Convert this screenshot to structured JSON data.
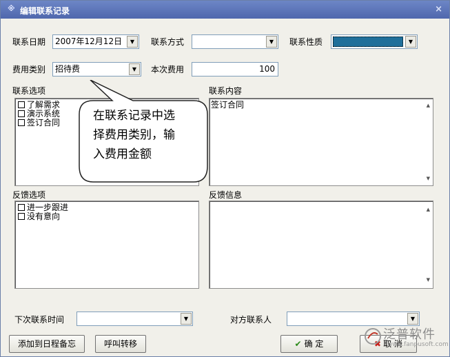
{
  "window": {
    "title": "编辑联系记录",
    "close_glyph": "×"
  },
  "form": {
    "contact_date_label": "联系日期",
    "contact_date_value": "2007年12月12日",
    "contact_method_label": "联系方式",
    "contact_method_value": "",
    "contact_nature_label": "联系性质",
    "contact_nature_value": "",
    "contact_nature_color": "#1f6f9a",
    "expense_type_label": "费用类别",
    "expense_type_value": "招待费",
    "expense_amount_label": "本次费用",
    "expense_amount_value": "100",
    "contact_options_label": "联系选项",
    "contact_options": [
      "了解需求",
      "演示系统",
      "签订合同"
    ],
    "contact_content_label": "联系内容",
    "contact_content_value": "签订合同",
    "feedback_options_label": "反馈选项",
    "feedback_options": [
      "进一步跟进",
      "没有意向"
    ],
    "feedback_info_label": "反馈信息",
    "feedback_info_value": "",
    "next_contact_label": "下次联系时间",
    "next_contact_value": "",
    "counterpart_label": "对方联系人",
    "counterpart_value": ""
  },
  "buttons": {
    "add_schedule": "添加到日程备忘",
    "call_transfer": "呼叫转移",
    "ok": "确 定",
    "cancel": "取 消"
  },
  "callout": {
    "line1": "在联系记录中选",
    "line2": "择费用类别，输",
    "line3": "入费用金额"
  },
  "watermark": {
    "brand": "泛普软件",
    "site": "www.fanpusoft.com"
  },
  "icons": {
    "dropdown": "chevron-down-icon",
    "checkbox": "checkbox-icon",
    "ok": "check-icon",
    "cancel": "x-icon"
  }
}
